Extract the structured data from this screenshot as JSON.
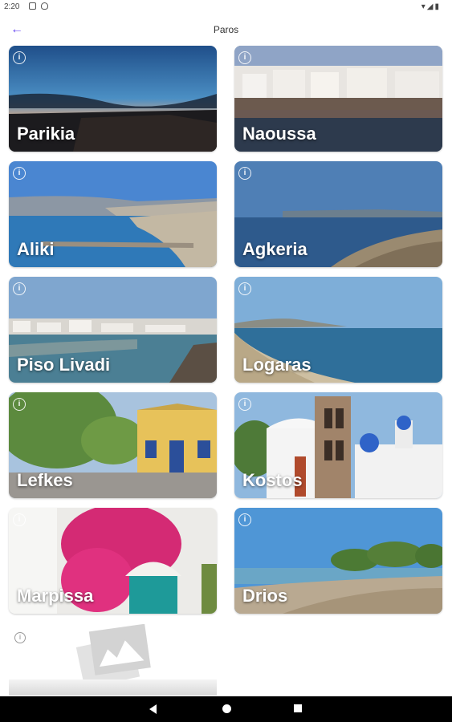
{
  "status": {
    "time": "2:20"
  },
  "header": {
    "title": "Paros"
  },
  "cards": [
    {
      "name": "Parikia"
    },
    {
      "name": "Naoussa"
    },
    {
      "name": "Aliki"
    },
    {
      "name": "Agkeria"
    },
    {
      "name": "Piso Livadi"
    },
    {
      "name": "Logaras"
    },
    {
      "name": "Lefkes"
    },
    {
      "name": "Kostos"
    },
    {
      "name": "Marpissa"
    },
    {
      "name": "Drios"
    }
  ],
  "icons": {
    "back": "arrow-left-icon",
    "info": "info-icon",
    "placeholder": "image-placeholder-icon"
  },
  "colors": {
    "accent": "#6a4cf2"
  }
}
